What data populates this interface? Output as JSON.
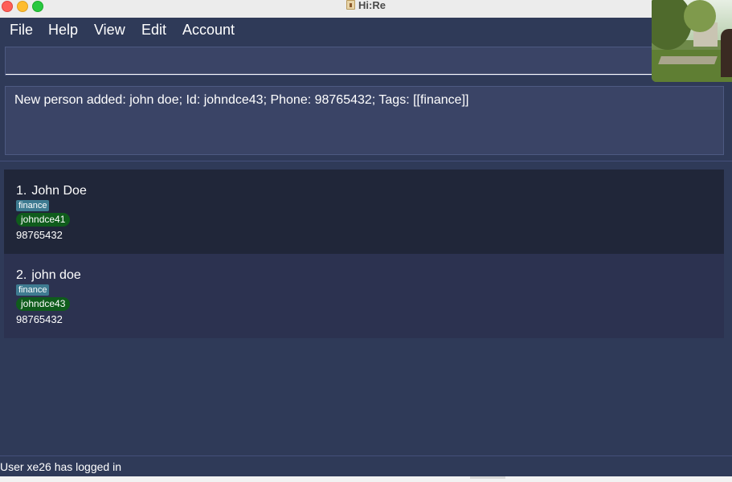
{
  "window": {
    "title": "Hi:Re"
  },
  "menu": {
    "items": [
      "File",
      "Help",
      "View",
      "Edit",
      "Account"
    ]
  },
  "command_box": {
    "value": "",
    "placeholder": ""
  },
  "result": {
    "text": "New person added: john doe; Id: johndce43; Phone: 98765432; Tags: [[finance]]"
  },
  "persons": [
    {
      "index": "1.",
      "name": "John Doe",
      "tag": "finance",
      "id": "johndce41",
      "phone": "98765432"
    },
    {
      "index": "2.",
      "name": "john doe",
      "tag": "finance",
      "id": "johndce43",
      "phone": "98765432"
    }
  ],
  "status": {
    "text": "User xe26 has logged in"
  },
  "colors": {
    "background": "#2f3a58",
    "card_dark": "#202639",
    "card_light": "#2c3250",
    "tag": "#3e7b91",
    "id_pill": "#0f5c1c",
    "close_button": "#fe5f57",
    "minimize_button": "#febc2e",
    "maximize_button": "#28c840"
  }
}
